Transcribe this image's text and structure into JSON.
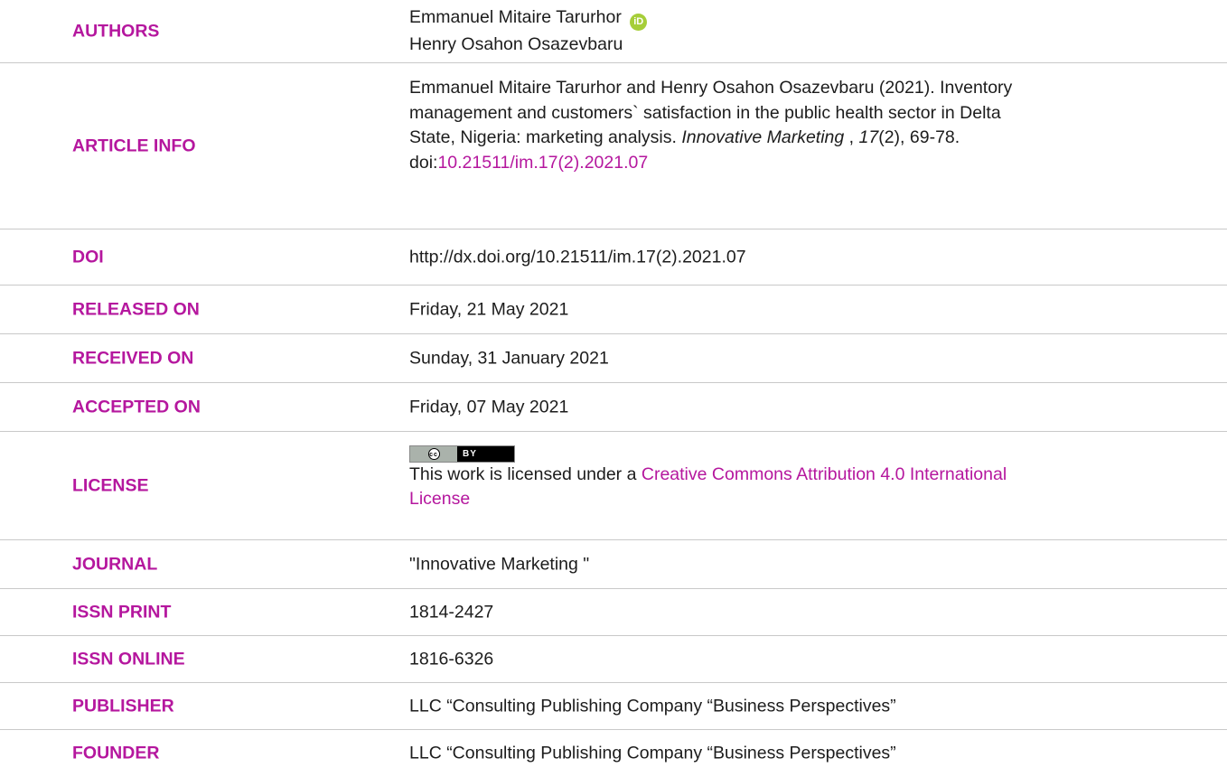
{
  "labels": {
    "authors": "AUTHORS",
    "article_info": "ARTICLE INFO",
    "doi": "DOI",
    "released_on": "RELEASED ON",
    "received_on": "RECEIVED ON",
    "accepted_on": "ACCEPTED ON",
    "license": "LICENSE",
    "journal": "JOURNAL",
    "issn_print": "ISSN PRINT",
    "issn_online": "ISSN ONLINE",
    "publisher": "PUBLISHER",
    "founder": "FOUNDER"
  },
  "authors": {
    "author1": "Emmanuel Mitaire Tarurhor",
    "orcid_icon_text": "iD",
    "author2": "Henry Osahon Osazevbaru"
  },
  "article_info": {
    "line1": "Emmanuel Mitaire Tarurhor and Henry Osahon Osazevbaru (2021). Inventory",
    "line2": "management and customers` satisfaction in the public health sector in Delta",
    "line3_pre": "State, Nigeria: marketing analysis. ",
    "journal_italic": "Innovative Marketing",
    "sep": " , ",
    "volume_italic": "17",
    "issue_pages": "(2), 69-78.",
    "doi_prefix": "doi:",
    "doi_link": "10.21511/im.17(2).2021.07"
  },
  "doi": "http://dx.doi.org/10.21511/im.17(2).2021.07",
  "released_on": "Friday, 21 May 2021",
  "received_on": "Sunday, 31 January 2021",
  "accepted_on": "Friday, 07 May 2021",
  "license": {
    "badge_cc": "(cc)",
    "badge_by": "BY",
    "text_pre": "This work is licensed under a ",
    "link_line1": "Creative Commons Attribution 4.0 International",
    "link_line2": "License"
  },
  "journal": "\"Innovative Marketing \"",
  "issn_print": "1814-2427",
  "issn_online": "1816-6326",
  "publisher": "LLC “Consulting Publishing Company “Business Perspectives”",
  "founder": "LLC “Consulting Publishing Company “Business Perspectives”",
  "colors": {
    "label": "#b5179e",
    "link": "#b5179e",
    "orcid": "#a6ce39",
    "divider": "#c9c9c9"
  }
}
